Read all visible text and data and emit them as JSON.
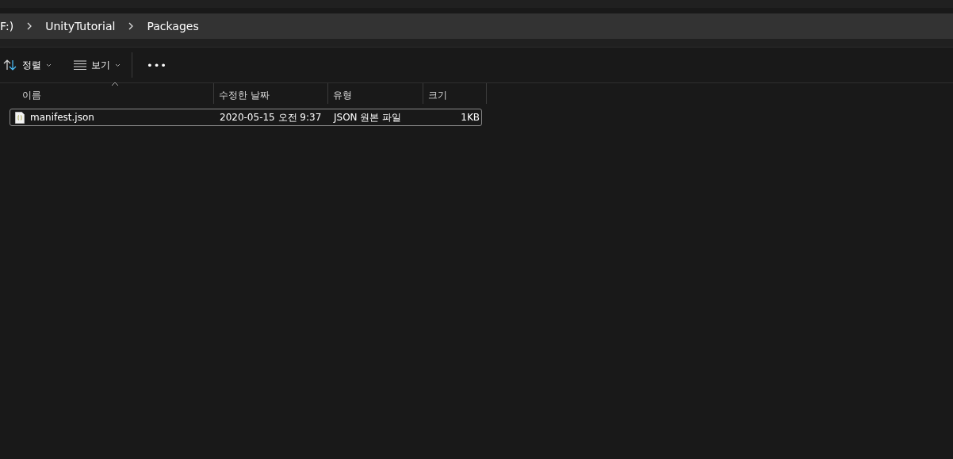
{
  "breadcrumb": [
    {
      "label": "F:)"
    },
    {
      "label": "UnityTutorial"
    },
    {
      "label": "Packages"
    }
  ],
  "toolbar": {
    "sort": {
      "label": "정렬"
    },
    "view": {
      "label": "보기"
    },
    "more": {
      "label": "•••"
    }
  },
  "table": {
    "columns": [
      {
        "label": "이름",
        "sorted": true
      },
      {
        "label": "수정한 날짜",
        "sorted": false
      },
      {
        "label": "유형",
        "sorted": false
      },
      {
        "label": "크기",
        "sorted": false
      }
    ],
    "rows": [
      {
        "name": "manifest.json",
        "modified": "2020-05-15 오전 9:37",
        "type": "JSON 원본 파일",
        "size": "1KB",
        "focused": true
      }
    ]
  }
}
